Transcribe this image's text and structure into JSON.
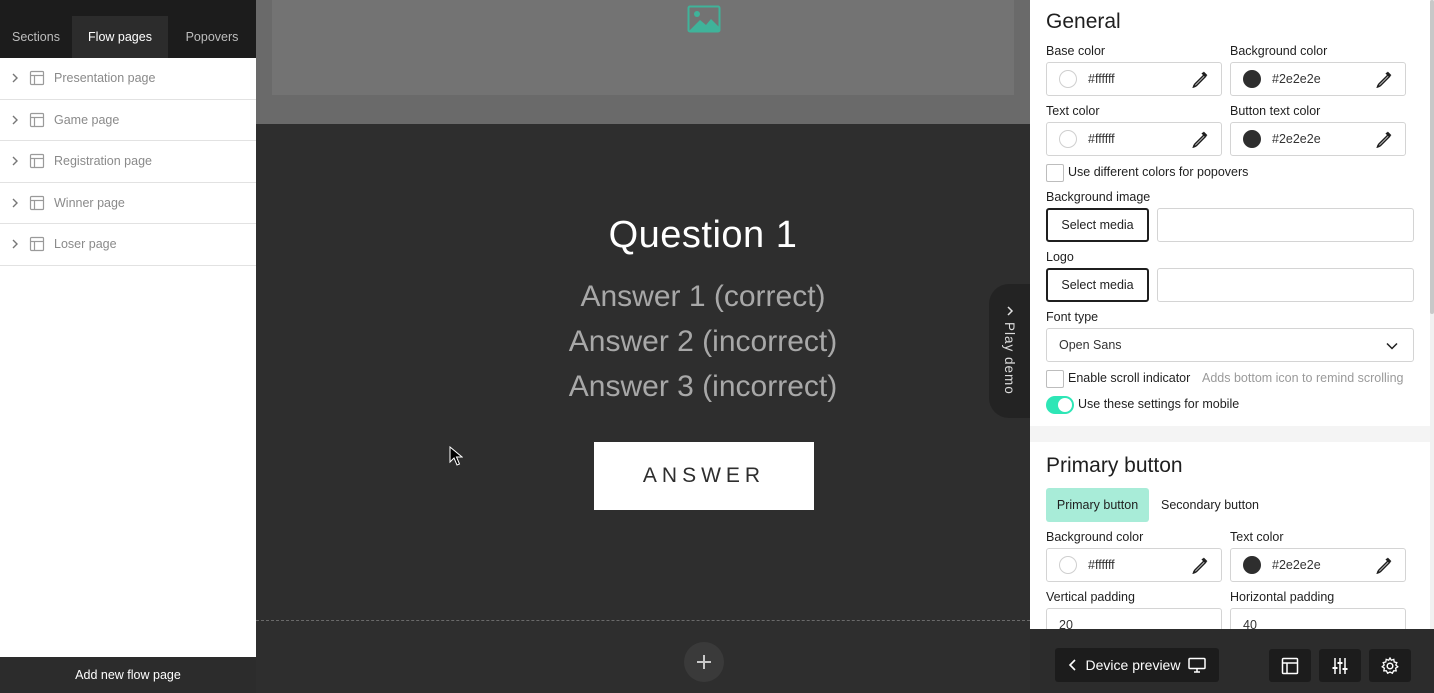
{
  "sidebar": {
    "tabs": [
      {
        "label": "Sections"
      },
      {
        "label": "Flow pages"
      },
      {
        "label": "Popovers"
      }
    ],
    "pages": [
      {
        "label": "Presentation page"
      },
      {
        "label": "Game page"
      },
      {
        "label": "Registration page"
      },
      {
        "label": "Winner page"
      },
      {
        "label": "Loser page"
      }
    ],
    "add_label": "Add new flow page"
  },
  "canvas": {
    "question": "Question 1",
    "answers": [
      "Answer 1 (correct)",
      "Answer 2 (incorrect)",
      "Answer 3 (incorrect)"
    ],
    "answer_button": "ANSWER",
    "play_demo": "Play demo"
  },
  "panel": {
    "general": {
      "title": "General",
      "base_color": {
        "label": "Base color",
        "value": "#ffffff"
      },
      "background_color": {
        "label": "Background color",
        "value": "#2e2e2e"
      },
      "text_color": {
        "label": "Text color",
        "value": "#ffffff"
      },
      "button_text_color": {
        "label": "Button text color",
        "value": "#2e2e2e"
      },
      "popover_colors_label": "Use different colors for popovers",
      "background_image_label": "Background image",
      "logo_label": "Logo",
      "select_media": "Select media",
      "font_type_label": "Font type",
      "font_type_value": "Open Sans",
      "scroll_indicator_label": "Enable scroll indicator",
      "scroll_indicator_hint": "Adds bottom icon to remind scrolling",
      "mobile_label": "Use these settings for mobile"
    },
    "primary_button": {
      "title": "Primary button",
      "tabs": [
        {
          "label": "Primary button"
        },
        {
          "label": "Secondary button"
        }
      ],
      "background_color": {
        "label": "Background color",
        "value": "#ffffff"
      },
      "text_color": {
        "label": "Text color",
        "value": "#2e2e2e"
      },
      "vertical_padding": {
        "label": "Vertical padding",
        "value": "20"
      },
      "horizontal_padding": {
        "label": "Horizontal padding",
        "value": "40"
      }
    },
    "device_preview": "Device preview"
  },
  "colors": {
    "accent": "#2ee6b6",
    "accent_light": "#a8ecd8",
    "canvas_bg": "#2e2e2e",
    "dark_bar": "#1c1c1c"
  },
  "icons": [
    "chevron-right-icon",
    "page-layout-icon",
    "image-placeholder-icon",
    "plus-icon",
    "eyedropper-icon",
    "chevron-down-icon",
    "monitor-icon",
    "sliders-icon",
    "gear-icon",
    "mouse-cursor-icon"
  ]
}
